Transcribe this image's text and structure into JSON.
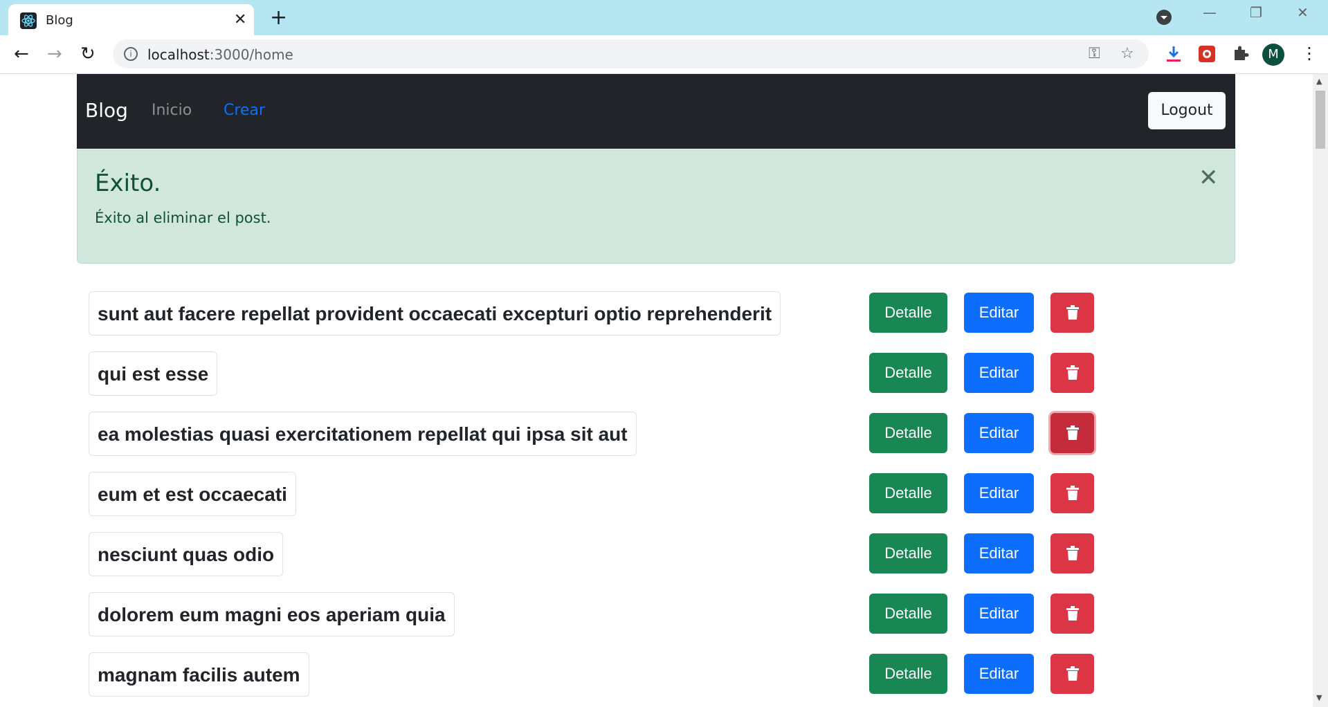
{
  "browser": {
    "tab_title": "Blog",
    "tab_close": "✕",
    "new_tab": "+",
    "url_host": "localhost",
    "url_path": ":3000/home",
    "avatar_letter": "M"
  },
  "navbar": {
    "brand": "Blog",
    "links": [
      {
        "label": "Inicio",
        "color": "#8c8f93"
      },
      {
        "label": "Crear",
        "color": "#0d6efd"
      }
    ],
    "logout_label": "Logout"
  },
  "alert": {
    "heading": "Éxito.",
    "message": "Éxito al eliminar el post.",
    "close_symbol": "✕"
  },
  "colors": {
    "success": "#198754",
    "primary": "#0d6efd",
    "danger": "#dc3545",
    "navbar_bg": "#212529",
    "alert_bg": "#d1e7dd"
  },
  "post_actions": {
    "detail_label": "Detalle",
    "edit_label": "Editar",
    "delete_icon": "trash-icon"
  },
  "posts": [
    {
      "title": "sunt aut facere repellat provident occaecati excepturi optio reprehenderit"
    },
    {
      "title": "qui est esse"
    },
    {
      "title": "ea molestias quasi exercitationem repellat qui ipsa sit aut"
    },
    {
      "title": "eum et est occaecati"
    },
    {
      "title": "nesciunt quas odio"
    },
    {
      "title": "dolorem eum magni eos aperiam quia"
    },
    {
      "title": "magnam facilis autem"
    }
  ]
}
